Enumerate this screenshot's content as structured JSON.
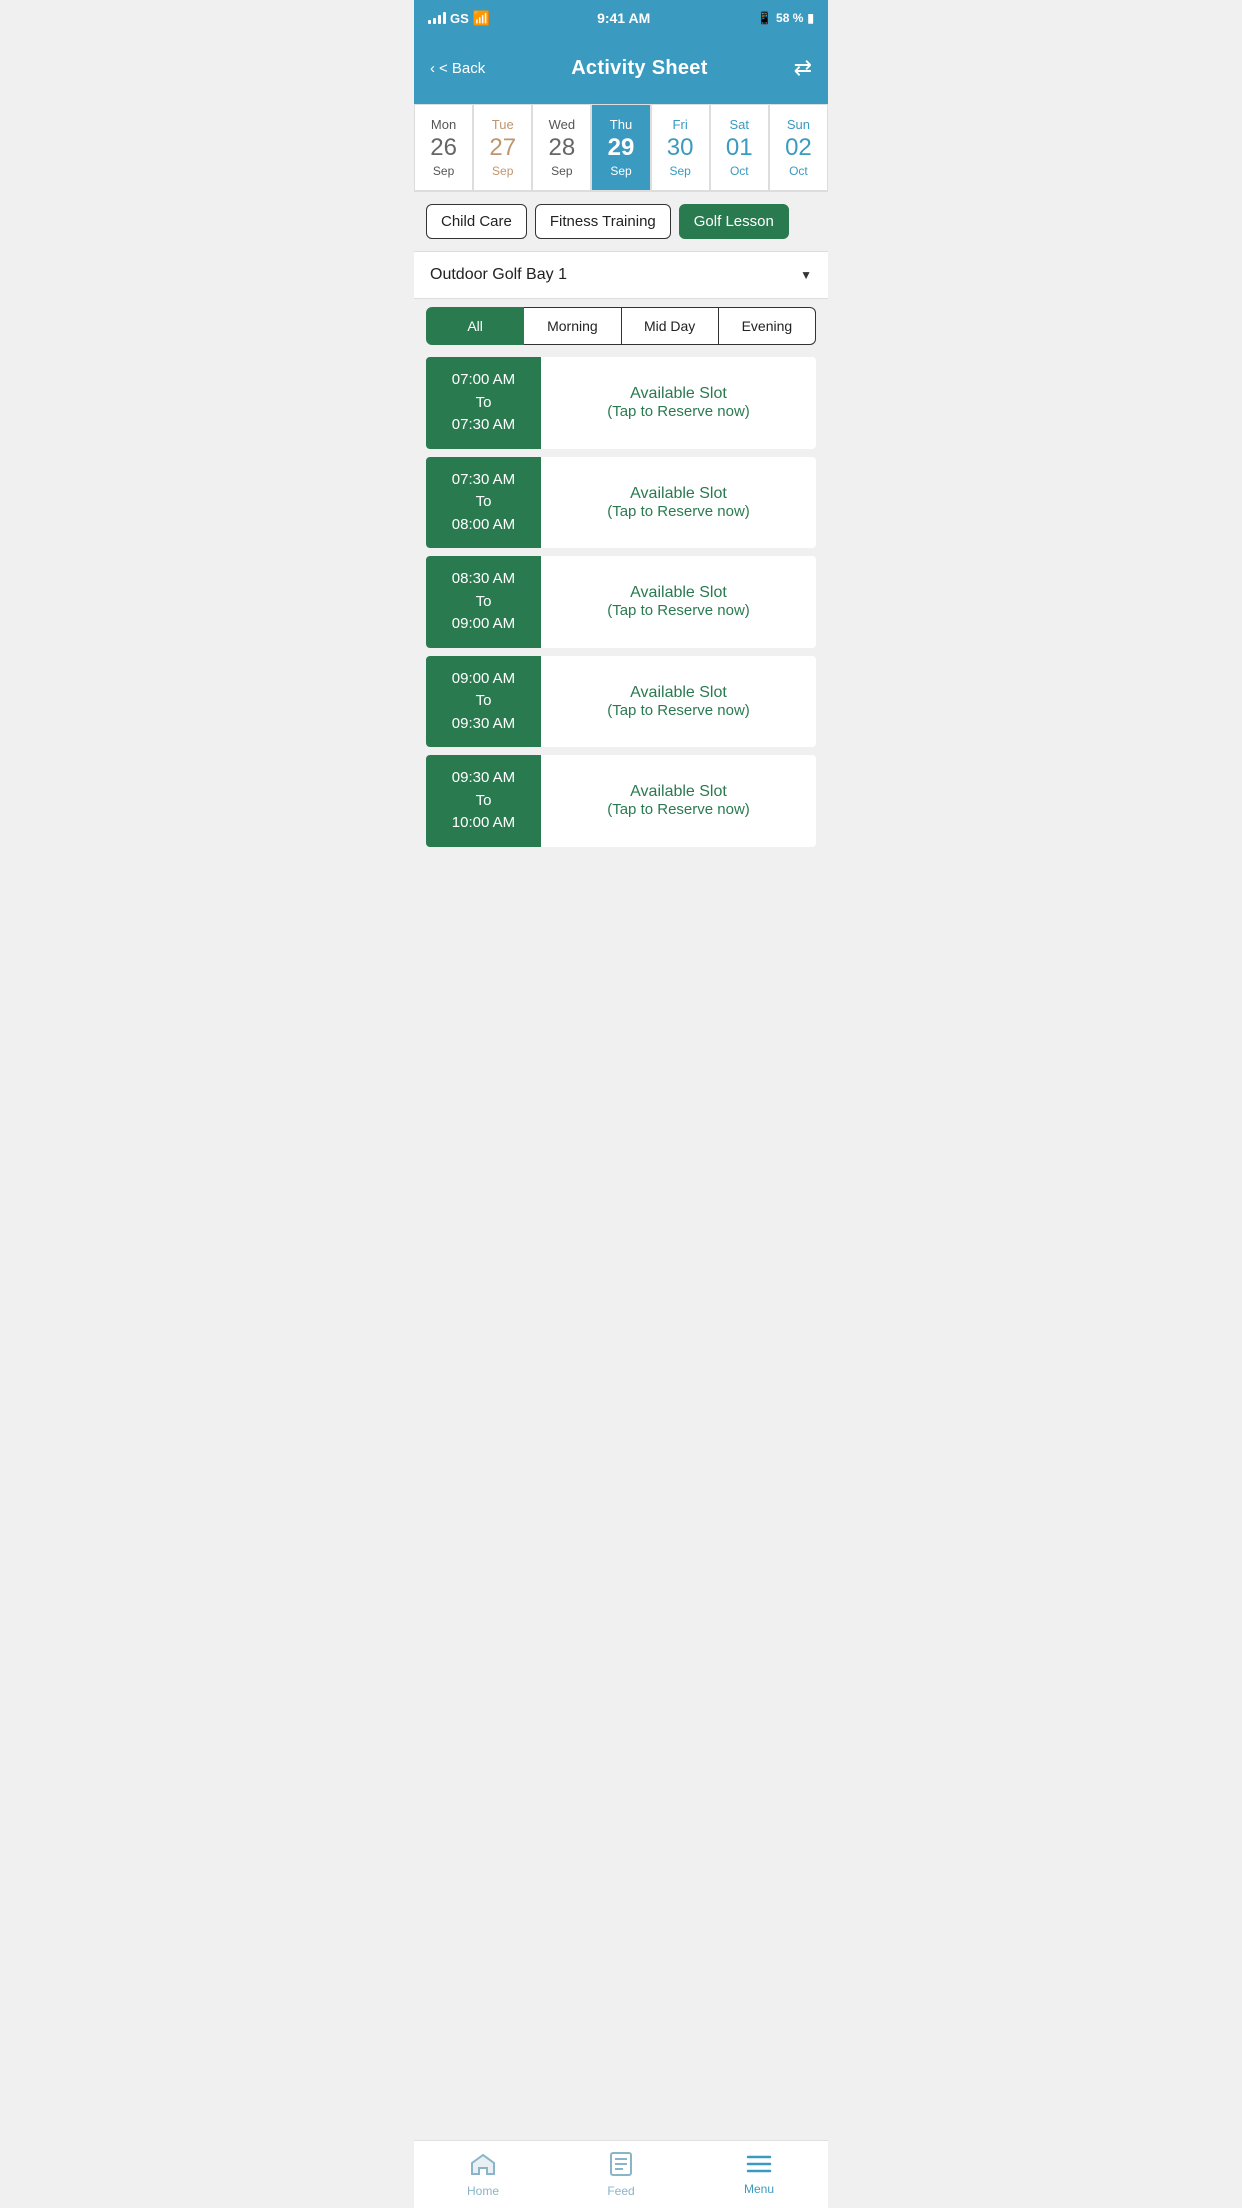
{
  "statusBar": {
    "time": "9:41 AM",
    "carrier": "GS",
    "battery": "58 %",
    "bluetooth": "BT"
  },
  "header": {
    "backLabel": "< Back",
    "title": "Activity Sheet"
  },
  "calendar": {
    "days": [
      {
        "name": "Mon",
        "num": "26",
        "month": "Sep",
        "type": "normal",
        "id": "mon-26"
      },
      {
        "name": "Tue",
        "num": "27",
        "month": "Sep",
        "type": "today",
        "id": "tue-27"
      },
      {
        "name": "Wed",
        "num": "28",
        "month": "Sep",
        "type": "normal",
        "id": "wed-28"
      },
      {
        "name": "Thu",
        "num": "29",
        "month": "Sep",
        "type": "active",
        "id": "thu-29"
      },
      {
        "name": "Fri",
        "num": "30",
        "month": "Sep",
        "type": "weekend",
        "id": "fri-30"
      },
      {
        "name": "Sat",
        "num": "01",
        "month": "Oct",
        "type": "weekend",
        "id": "sat-01"
      },
      {
        "name": "Sun",
        "num": "02",
        "month": "Oct",
        "type": "weekend",
        "id": "sun-02"
      }
    ]
  },
  "categories": [
    {
      "id": "child-care",
      "label": "Child Care",
      "active": false
    },
    {
      "id": "fitness-training",
      "label": "Fitness Training",
      "active": false
    },
    {
      "id": "golf-lesson",
      "label": "Golf Lesson",
      "active": true
    }
  ],
  "venue": {
    "label": "Outdoor Golf Bay 1",
    "dropdownArrow": "▼"
  },
  "timeFilters": [
    {
      "id": "all",
      "label": "All",
      "active": true
    },
    {
      "id": "morning",
      "label": "Morning",
      "active": false
    },
    {
      "id": "midday",
      "label": "Mid Day",
      "active": false
    },
    {
      "id": "evening",
      "label": "Evening",
      "active": false
    }
  ],
  "slots": [
    {
      "id": "slot-1",
      "timeFrom": "07:00 AM",
      "timeTo": "07:30 AM",
      "timeLabel": "07:00 AM\nTo\n07:30 AM",
      "available": "Available Slot",
      "tap": "(Tap to Reserve now)"
    },
    {
      "id": "slot-2",
      "timeFrom": "07:30 AM",
      "timeTo": "08:00 AM",
      "timeLabel": "07:30 AM\nTo\n08:00 AM",
      "available": "Available Slot",
      "tap": "(Tap to Reserve now)"
    },
    {
      "id": "slot-3",
      "timeFrom": "08:30 AM",
      "timeTo": "09:00 AM",
      "timeLabel": "08:30 AM\nTo\n09:00 AM",
      "available": "Available Slot",
      "tap": "(Tap to Reserve now)"
    },
    {
      "id": "slot-4",
      "timeFrom": "09:00 AM",
      "timeTo": "09:30 AM",
      "timeLabel": "09:00 AM\nTo\n09:30 AM",
      "available": "Available Slot",
      "tap": "(Tap to Reserve now)"
    },
    {
      "id": "slot-5",
      "timeFrom": "09:30 AM",
      "timeTo": "10:00 AM",
      "timeLabel": "09:30 AM\nTo\n10:00 AM",
      "available": "Available Slot",
      "tap": "(Tap to Reserve now)"
    }
  ],
  "bottomNav": {
    "items": [
      {
        "id": "home",
        "label": "Home",
        "icon": "home",
        "active": false
      },
      {
        "id": "feed",
        "label": "Feed",
        "icon": "feed",
        "active": false
      },
      {
        "id": "menu",
        "label": "Menu",
        "icon": "menu",
        "active": true
      }
    ]
  }
}
